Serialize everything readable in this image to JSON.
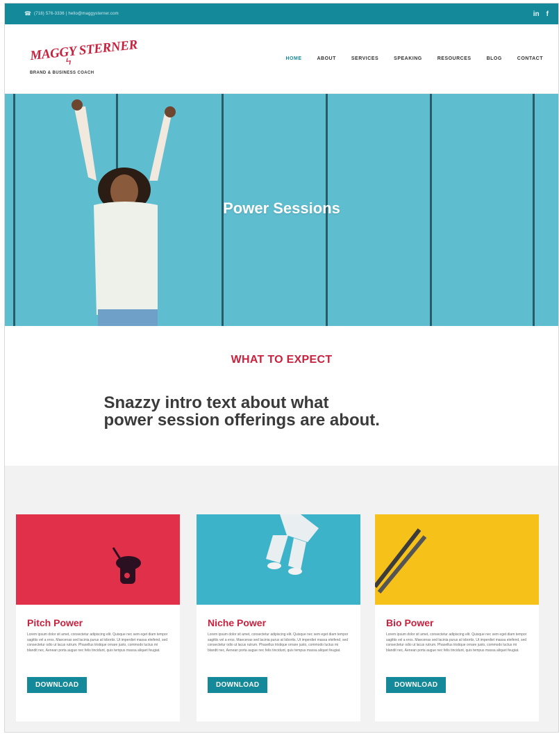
{
  "topbar": {
    "contact_text": "(718) 576-3336 | hello@maggysterner.com",
    "social": {
      "linkedin": "in",
      "facebook": "f"
    }
  },
  "logo": {
    "name": "MAGGY STERNER",
    "tagline": "BRAND & BUSINESS COACH"
  },
  "nav": {
    "items": [
      {
        "label": "HOME",
        "active": true
      },
      {
        "label": "ABOUT"
      },
      {
        "label": "SERVICES"
      },
      {
        "label": "SPEAKING"
      },
      {
        "label": "RESOURCES"
      },
      {
        "label": "BLOG"
      },
      {
        "label": "CONTACT"
      }
    ]
  },
  "hero": {
    "title": "Power Sessions"
  },
  "expect": {
    "label": "WHAT TO EXPECT",
    "intro_line1": "Snazzy intro text about what",
    "intro_line2": "power session offerings are about."
  },
  "cards": [
    {
      "title": "Pitch Power",
      "body": "Lorem ipsum dolor sit amet, consectetur adipiscing elit. Quisque nec sem eget diam tempor sagittis vel a eros. Maecenas sed lacinia purus at lobortis. Ut imperdiet massa eleifend, sed consectetur odio ut lacus rutrum. Phasellus tristique ornare justo, commodo luctus mi blandit nec, Aenean porta augue nec felis tincidunt, quis tempus massa aliquet feugiat.",
      "button": "DOWNLOAD",
      "color": "#e0304a"
    },
    {
      "title": "Niche Power",
      "body": "Lorem ipsum dolor sit amet, consectetur adipiscing elit. Quisque nec sem eget diam tempor sagittis vel a eros. Maecenas sed lacinia purus at lobortis. Ut imperdiet massa eleifend, sed consectetur odio ut lacus rutrum. Phasellus tristique ornare justo, commodo luctus mi blandit nec, Aenean porta augue nec felis tincidunt, quis tempus massa aliquet feugiat.",
      "button": "DOWNLOAD",
      "color": "#3cb3c9"
    },
    {
      "title": "Bio Power",
      "body": "Lorem ipsum dolor sit amet, consectetur adipiscing elit. Quisque nec sem eget diam tempor sagittis vel a eros. Maecenas sed lacinia purus at lobortis. Ut imperdiet massa eleifend, sed consectetur odio ut lacus rutrum. Phasellus tristique ornare justo, commodo luctus mi blandit nec, Aenean porta augue nec felis tincidunt, quis tempus massa aliquet feugiat.",
      "button": "DOWNLOAD",
      "color": "#f6c21a"
    }
  ],
  "colors": {
    "accent_teal": "#14899a",
    "brand_red": "#c8213d",
    "hero_blue": "#5fbdd0"
  }
}
